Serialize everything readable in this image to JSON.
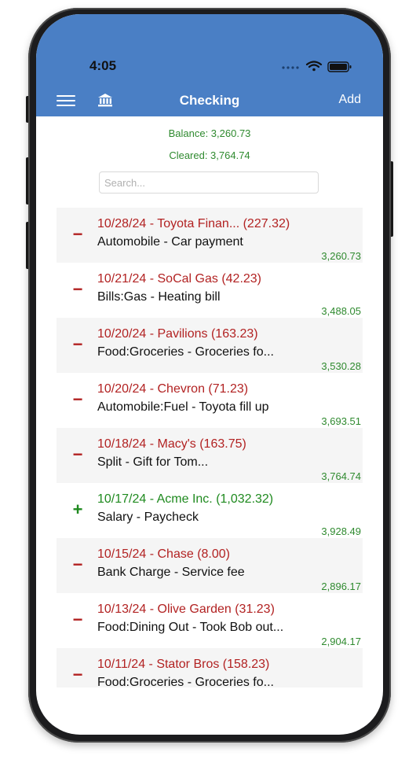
{
  "status": {
    "time": "4:05"
  },
  "nav": {
    "title": "Checking",
    "add_label": "Add",
    "menu_icon": "hamburger-menu-icon",
    "account_icon": "bank-icon"
  },
  "summary": {
    "balance": "Balance: 3,260.73",
    "cleared": "Cleared: 3,764.74"
  },
  "search": {
    "placeholder": "Search...",
    "value": ""
  },
  "colors": {
    "header": "#4a7fc5",
    "negative": "#b22222",
    "positive": "#1f8a1f",
    "balance": "#2f8a2f"
  },
  "transactions": [
    {
      "sign": "−",
      "type": "neg",
      "title": "10/28/24 - Toyota Finan... (227.32)",
      "desc": "Automobile - Car payment",
      "balance": "3,260.73"
    },
    {
      "sign": "−",
      "type": "neg",
      "title": "10/21/24 - SoCal Gas (42.23)",
      "desc": "Bills:Gas - Heating bill",
      "balance": "3,488.05"
    },
    {
      "sign": "−",
      "type": "neg",
      "title": "10/20/24 - Pavilions (163.23)",
      "desc": "Food:Groceries - Groceries fo...",
      "balance": "3,530.28"
    },
    {
      "sign": "−",
      "type": "neg",
      "title": "10/20/24 - Chevron (71.23)",
      "desc": "Automobile:Fuel - Toyota fill up",
      "balance": "3,693.51"
    },
    {
      "sign": "−",
      "type": "neg",
      "title": "10/18/24 - Macy's (163.75)",
      "desc": "Split - Gift for Tom...",
      "balance": "3,764.74"
    },
    {
      "sign": "+",
      "type": "pos",
      "title": "10/17/24 - Acme Inc. (1,032.32)",
      "desc": "Salary - Paycheck",
      "balance": "3,928.49"
    },
    {
      "sign": "−",
      "type": "neg",
      "title": "10/15/24 - Chase (8.00)",
      "desc": "Bank Charge - Service fee",
      "balance": "2,896.17"
    },
    {
      "sign": "−",
      "type": "neg",
      "title": "10/13/24 - Olive Garden (31.23)",
      "desc": "Food:Dining Out - Took Bob out...",
      "balance": "2,904.17"
    },
    {
      "sign": "−",
      "type": "neg",
      "title": "10/11/24 - Stator Bros (158.23)",
      "desc": "Food:Groceries - Groceries fo...",
      "balance": ""
    }
  ]
}
